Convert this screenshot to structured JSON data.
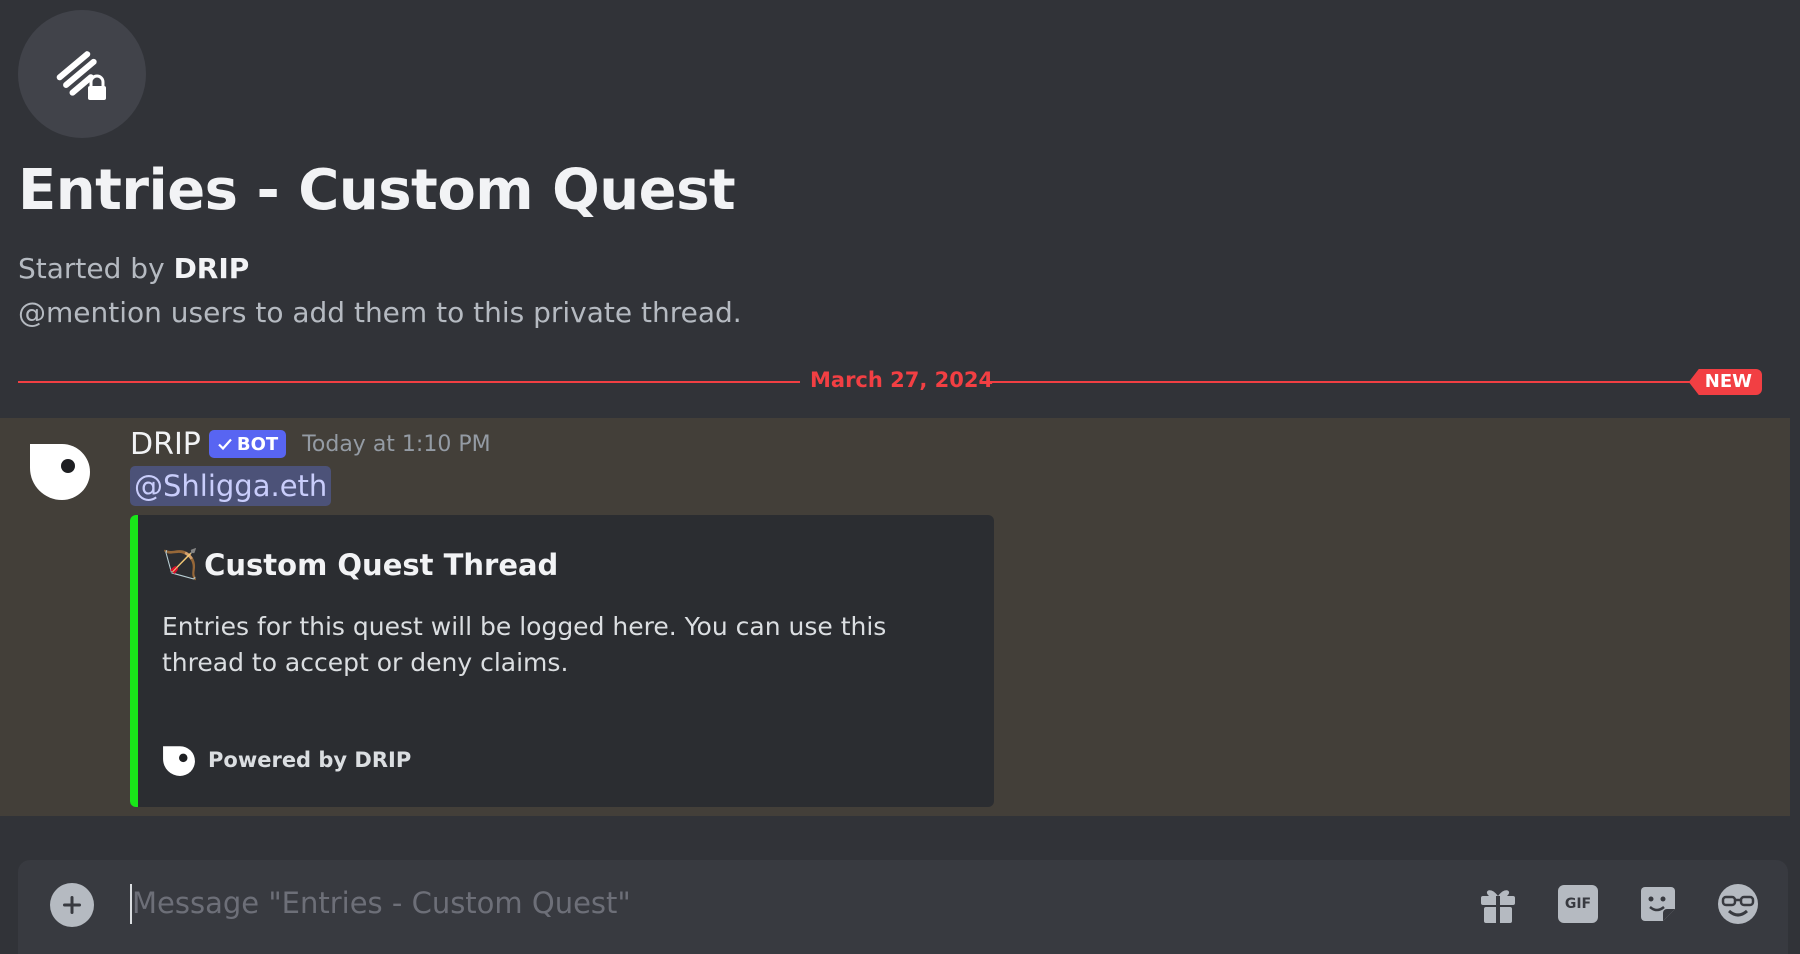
{
  "thread": {
    "title": "Entries - Custom Quest",
    "started_by_prefix": "Started by",
    "started_by_name": "DRIP",
    "hint": "@mention users to add them to this private thread."
  },
  "divider": {
    "date": "March 27, 2024",
    "badge": "NEW"
  },
  "message": {
    "author": "DRIP",
    "bot_tag": "BOT",
    "timestamp": "Today at 1:10 PM",
    "mention": "@Shligga.eth",
    "embed": {
      "accent_color": "#19e619",
      "title_emoji": "🏹",
      "title": "Custom Quest Thread",
      "description": "Entries for this quest will be logged here. You can use this thread to accept or deny claims.",
      "footer": "Powered by DRIP"
    }
  },
  "composer": {
    "placeholder": "Message \"Entries - Custom Quest\"",
    "value": "",
    "gif_label": "GIF"
  },
  "colors": {
    "background": "#313338",
    "highlight": "#433f39",
    "new_divider": "#f23f43",
    "bot_tag": "#5865f2",
    "mention_bg": "#4c5278"
  },
  "icons": [
    "thread-lock-icon",
    "drip-avatar-icon",
    "checkmark-icon",
    "plus-icon",
    "gift-icon",
    "gif-icon",
    "sticker-icon",
    "emoji-icon"
  ]
}
